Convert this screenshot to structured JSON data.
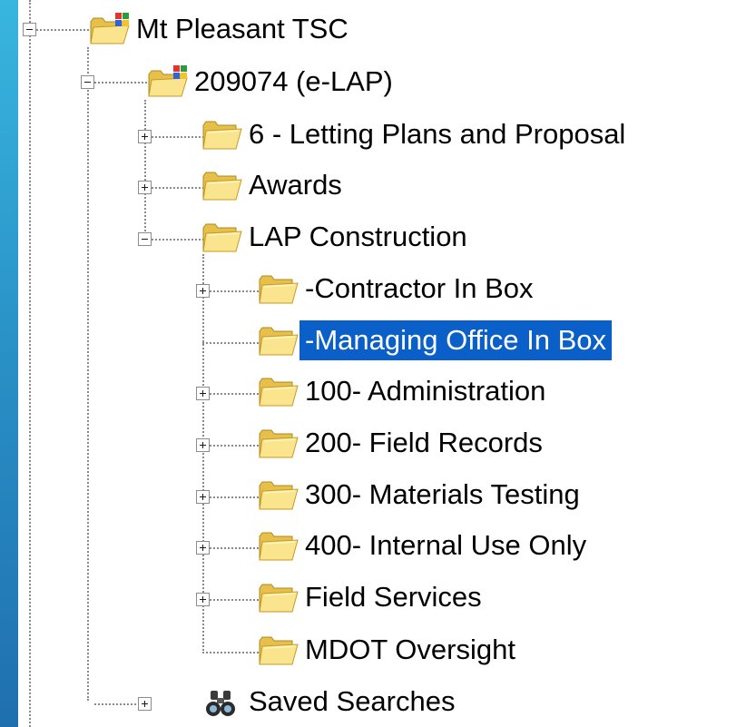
{
  "tree": {
    "root": {
      "label": "Mt Pleasant TSC",
      "icon": "project-folder-icon",
      "state": "expanded"
    },
    "project": {
      "label": "209074 (e-LAP)",
      "icon": "project-folder-icon",
      "state": "expanded"
    },
    "letting": {
      "label": "6 - Letting Plans and Proposal",
      "icon": "folder-icon",
      "state": "collapsed"
    },
    "awards": {
      "label": "Awards",
      "icon": "folder-icon",
      "state": "collapsed"
    },
    "lap_construction": {
      "label": "LAP Construction",
      "icon": "folder-icon",
      "state": "expanded"
    },
    "contractor_inbox": {
      "label": "-Contractor In Box",
      "icon": "folder-icon",
      "state": "collapsed"
    },
    "managing_office_inbox": {
      "label": "-Managing Office In Box",
      "icon": "folder-icon",
      "state": "leaf",
      "selected": true
    },
    "administration": {
      "label": "100- Administration",
      "icon": "folder-icon",
      "state": "collapsed"
    },
    "field_records": {
      "label": "200- Field Records",
      "icon": "folder-icon",
      "state": "collapsed"
    },
    "materials_testing": {
      "label": "300- Materials Testing",
      "icon": "folder-icon",
      "state": "collapsed"
    },
    "internal_use": {
      "label": "400- Internal Use Only",
      "icon": "folder-icon",
      "state": "collapsed"
    },
    "field_services": {
      "label": "Field Services",
      "icon": "folder-icon",
      "state": "collapsed"
    },
    "mdot_oversight": {
      "label": "MDOT Oversight",
      "icon": "folder-icon",
      "state": "leaf"
    },
    "saved_searches": {
      "label": "Saved Searches",
      "icon": "binoculars-icon",
      "state": "collapsed"
    }
  },
  "colors": {
    "selection": "#0a5fc8",
    "folder": "#f5d76e",
    "background_gradient_top": "#38b6df"
  }
}
